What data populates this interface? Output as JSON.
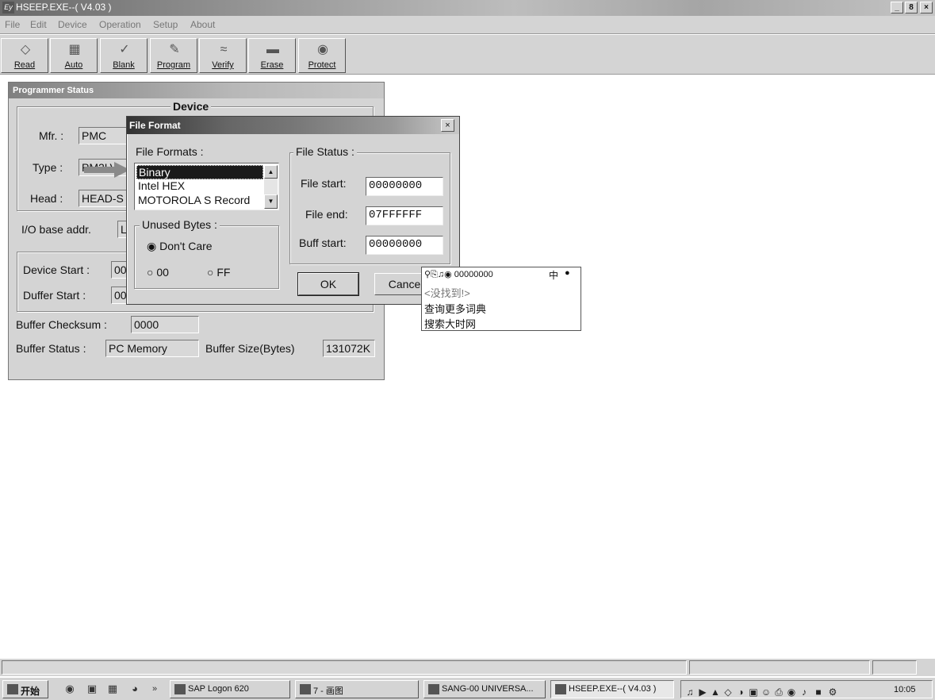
{
  "window": {
    "title": "HSEEP.EXE--( V4.03 )",
    "icon_text": "Ey",
    "controls": [
      "_",
      "8",
      "×"
    ]
  },
  "menu": [
    "File",
    "Edit",
    "Device",
    "Operation",
    "Setup",
    "About"
  ],
  "toolbar": [
    {
      "label": "Read",
      "icon": "read-icon"
    },
    {
      "label": "Auto",
      "icon": "auto-icon"
    },
    {
      "label": "Blank",
      "icon": "blank-icon"
    },
    {
      "label": "Program",
      "icon": "program-icon"
    },
    {
      "label": "Verify",
      "icon": "verify-icon"
    },
    {
      "label": "Erase",
      "icon": "erase-icon"
    },
    {
      "label": "Protect",
      "icon": "lock-icon"
    }
  ],
  "programmer_status": {
    "title": "Programmer Status",
    "device_group": "Device",
    "mfr_label": "Mfr. :",
    "mfr_value": "PMC",
    "type_label": "Type :",
    "type_value": "PM2LV",
    "head_label": "Head :",
    "head_value": "HEAD-S",
    "io_label": "I/O base addr.",
    "io_value": "L",
    "device_start_label": "Device Start :",
    "device_start_value": "00",
    "buffer_start_label": "Duffer Start :",
    "buffer_start_value": "00",
    "checksum_label": "Buffer Checksum :",
    "checksum_value": "0000",
    "buffer_status_label": "Buffer Status :",
    "buffer_status_value": "PC Memory",
    "buffer_size_label": "Buffer Size(Bytes)",
    "buffer_size_value": "131072K"
  },
  "file_format": {
    "title": "File Format",
    "close": "×",
    "formats_label": "File Formats :",
    "formats": [
      "Binary",
      "Intel HEX",
      "MOTOROLA S Record"
    ],
    "selected_format": "Binary",
    "unused_label": "Unused Bytes :",
    "unused_options": [
      "Don't Care",
      "00",
      "FF"
    ],
    "unused_selected": "Don't Care",
    "status_label": "File Status :",
    "file_start_label": "File start:",
    "file_start_value": "00000000",
    "file_end_label": "File end:",
    "file_end_value": "07FFFFFF",
    "buff_start_label": "Buff start:",
    "buff_start_value": "00000000",
    "ok": "OK",
    "cancel": "Cance"
  },
  "popup": {
    "toolbar_text": "00000000",
    "toolbar_right": "中",
    "not_found": "<没找到!>",
    "more": "查询更多词典",
    "search": "搜索大时网"
  },
  "taskbar": {
    "start": "开始",
    "tasks": [
      "SAP Logon 620",
      "7 - 画图",
      "SANG-00 UNIVERSA...",
      "HSEEP.EXE--( V4.03 )"
    ],
    "active_task": "HSEEP.EXE--( V4.03 )",
    "clock": "10:05"
  }
}
